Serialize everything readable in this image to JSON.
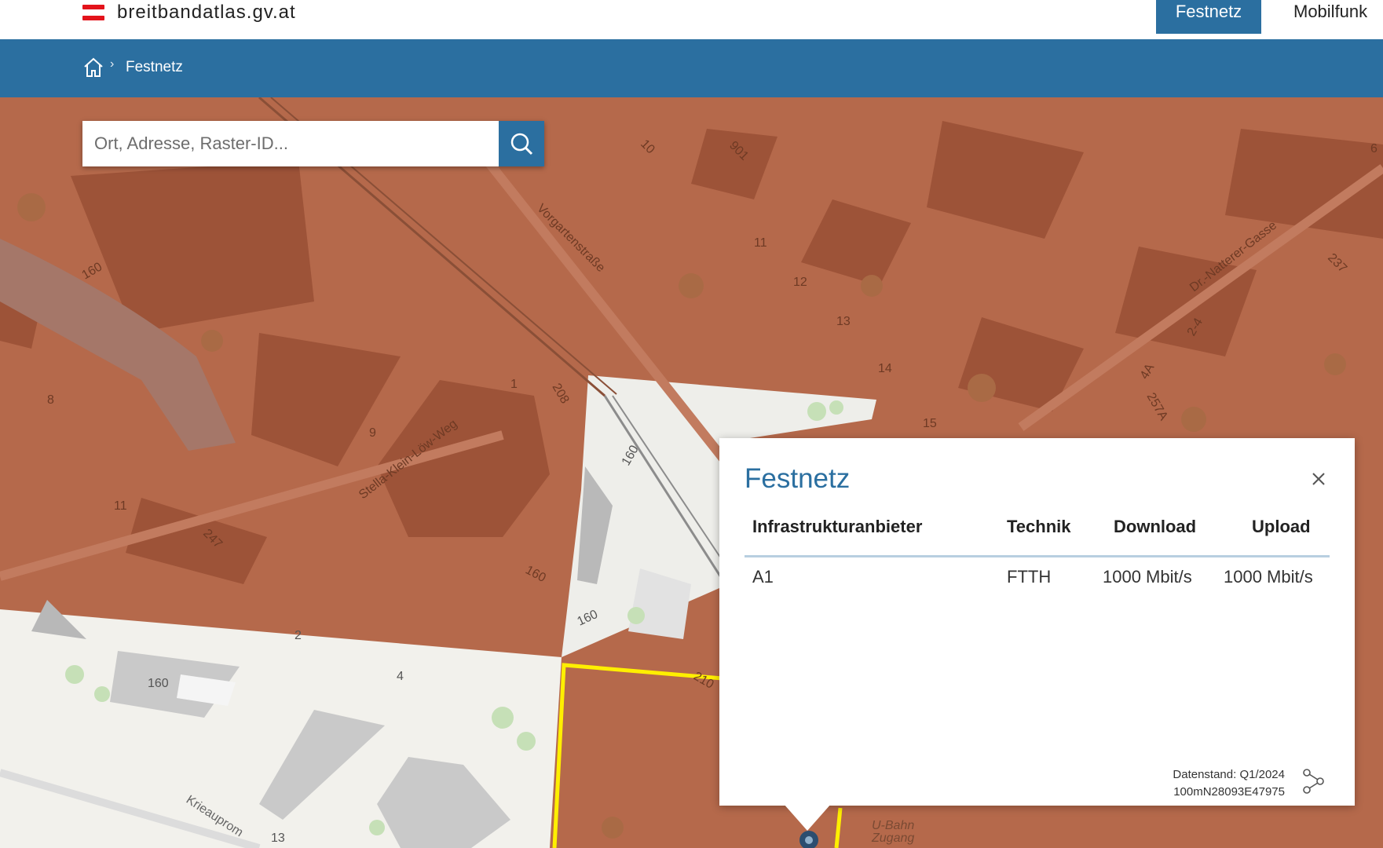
{
  "header": {
    "site_name": "breitbandatlas.gv.at",
    "nav": [
      {
        "label": "Festnetz",
        "active": true
      },
      {
        "label": "Mobilfunk",
        "active": false
      }
    ]
  },
  "breadcrumb": {
    "home_icon": "home-icon",
    "current": "Festnetz"
  },
  "search": {
    "placeholder": "Ort, Adresse, Raster-ID...",
    "icon": "search-icon"
  },
  "map": {
    "street_labels": [
      "Vorgartenstraße",
      "Stella-Klein-Löw-Weg",
      "Dr.-Natterer-Gasse",
      "Krieauprom",
      "U-Bahn",
      "Zugang"
    ],
    "number_labels": [
      "160",
      "160",
      "160",
      "160",
      "160",
      "208",
      "210",
      "247",
      "257A",
      "2-4",
      "4A",
      "1",
      "2",
      "4",
      "8",
      "9",
      "10",
      "11",
      "11",
      "12",
      "13",
      "13",
      "14",
      "15",
      "6",
      "901",
      "237"
    ],
    "coverage_color": "#b5694b",
    "selection_color": "#ffef00"
  },
  "popup": {
    "title": "Festnetz",
    "close_icon": "close-icon",
    "columns": [
      "Infrastrukturanbieter",
      "Technik",
      "Download",
      "Upload"
    ],
    "rows": [
      {
        "provider": "A1",
        "technology": "FTTH",
        "download": "1000 Mbit/s",
        "upload": "1000 Mbit/s"
      }
    ],
    "data_status": "Datenstand: Q1/2024",
    "raster_id": "100mN28093E47975",
    "share_icon": "share-icon"
  },
  "annotations": {
    "arrow_color": "#e3131b"
  }
}
